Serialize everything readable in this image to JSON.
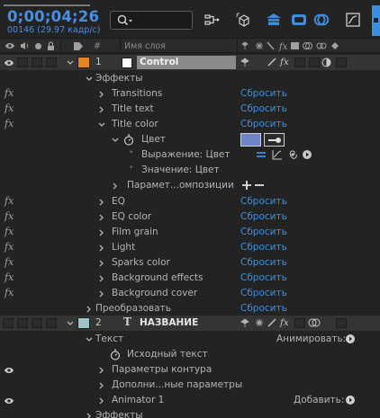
{
  "timecode": "0;00;04;26",
  "frames_info": "00146 (29.97 кадр/с)",
  "search": {
    "placeholder": ""
  },
  "columns": {
    "layer_name": "Имя слоя",
    "hash": "#"
  },
  "layers": [
    {
      "number": "1",
      "name": "Control",
      "label_color": "#e0851f",
      "type": "solid"
    },
    {
      "number": "2",
      "name": "НАЗВАНИЕ",
      "label_color": "#9fc6c6",
      "type": "text"
    }
  ],
  "rows": {
    "effects": "Эффекты",
    "transitions": "Transitions",
    "title_text": "Title text",
    "title_color": "Title color",
    "color": "Цвет",
    "expression": "Выражение: Цвет",
    "value": "Значение: Цвет",
    "param_comp": "Парамет...омпозиции",
    "eq": "EQ",
    "eq_color": "EQ color",
    "film_grain": "Film grain",
    "light": "Light",
    "sparks_color": "Sparks color",
    "background_effects": "Background effects",
    "background_cover": "Background cover",
    "transform": "Преобразовать",
    "text": "Текст",
    "source_text": "Исходный текст",
    "path_options": "Параметры контура",
    "more_options": "Дополни...ные параметры",
    "animator": "Animator 1",
    "effects2": "Эффекты"
  },
  "labels": {
    "reset": "Сбросить",
    "animate": "Анимировать:",
    "add": "Добавить:",
    "fx": "fx",
    "text_layer_glyph": "T"
  },
  "colors": {
    "accent_blue": "#3b8fe0",
    "color_swatch": "#6e86c8",
    "timecode_color": "#4a8ee0"
  }
}
